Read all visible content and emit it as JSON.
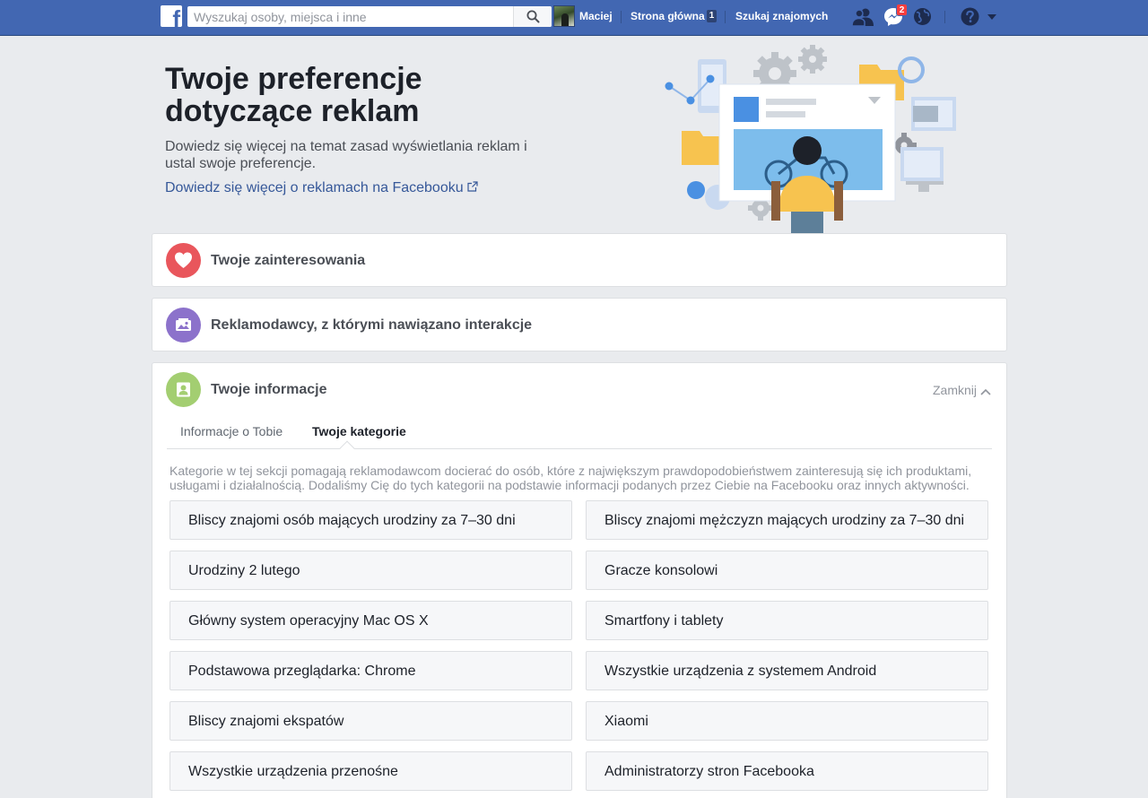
{
  "topbar": {
    "logo_letter": "f",
    "search_placeholder": "Wyszukaj osoby, miejsca i inne",
    "user_name": "Maciej",
    "home_label": "Strona główna",
    "home_count": "1",
    "find_friends_label": "Szukaj znajomych",
    "messages_badge": "2",
    "icons": [
      "friend-requests-icon",
      "messenger-icon",
      "globe-notifications-icon",
      "help-icon",
      "dropdown-caret-icon"
    ]
  },
  "hero": {
    "title": "Twoje preferencje dotyczące reklam",
    "description": "Dowiedz się więcej na temat zasad wyświetlania reklam i ustal swoje preferencje.",
    "link": "Dowiedz się więcej o reklamach na Facebooku"
  },
  "sections": {
    "interests": {
      "title": "Twoje zainteresowania",
      "color": "#e9565c",
      "icon": "heart-icon"
    },
    "advertisers": {
      "title": "Reklamodawcy, z którymi nawiązano interakcje",
      "color": "#8c72cb",
      "icon": "picture-icon"
    },
    "info": {
      "title": "Twoje informacje",
      "color": "#a3ce71",
      "icon": "person-card-icon",
      "close_label": "Zamknij",
      "tabs": [
        "Informacje o Tobie",
        "Twoje kategorie"
      ],
      "active_tab": "Twoje kategorie",
      "description": "Kategorie w tej sekcji pomagają reklamodawcom docierać do osób, które z największym prawdopodobieństwem zainteresują się ich produktami, usługami i działalnością. Dodaliśmy Cię do tych kategorii na podstawie informacji podanych przez Ciebie na Facebooku oraz innych aktywności.",
      "categories": [
        "Bliscy znajomi osób mających urodziny za 7–30 dni",
        "Bliscy znajomi mężczyzn mających urodziny za 7–30 dni",
        "Urodziny 2 lutego",
        "Gracze konsolowi",
        "Główny system operacyjny Mac OS X",
        "Smartfony i tablety",
        "Podstawowa przeglądarka: Chrome",
        "Wszystkie urządzenia z systemem Android",
        "Bliscy znajomi ekspatów",
        "Xiaomi",
        "Wszystkie urządzenia przenośne",
        "Administratorzy stron Facebooka"
      ]
    }
  },
  "colors": {
    "topbar": "#4267b2",
    "link": "#365899",
    "background": "#e9ebee"
  }
}
